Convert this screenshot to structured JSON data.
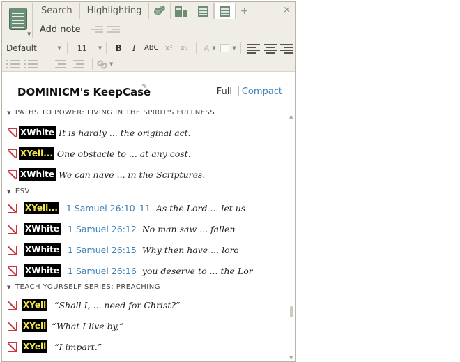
{
  "toolbar": {
    "tabs": [
      {
        "label": "Search"
      },
      {
        "label": "Highlighting"
      }
    ],
    "icon_tabs": [
      "gears-icon",
      "library-icon",
      "notes-icon",
      "notes-active-icon"
    ],
    "add_tab": "+",
    "close": "×",
    "add_note_label": "Add note",
    "style_select": "Default",
    "font_size": "11",
    "bold": "B",
    "italic": "I",
    "smallcaps": "ABC",
    "superscript": "x²",
    "subscript": "x₂",
    "font_color": "A"
  },
  "document": {
    "title": "DOMINICM's KeepCase",
    "view_full": "Full",
    "view_compact": "Compact"
  },
  "sections": [
    {
      "heading": "PATHS TO POWER: LIVING IN THE SPIRIT'S FULLNESS",
      "items": [
        {
          "badge": "XWhite",
          "badge_style": "white",
          "excerpt": "It is hardly ... the original act."
        },
        {
          "badge": "XYell...",
          "badge_style": "yell",
          "excerpt": "One obstacle to ... at any cost."
        },
        {
          "badge": "XWhite",
          "badge_style": "white",
          "excerpt": "We can have ... in the Scriptures."
        }
      ]
    },
    {
      "heading": "ESV",
      "items": [
        {
          "badge": "XYell...",
          "badge_style": "yell",
          "ref": "1 Samuel 26:10–11",
          "excerpt": "As the Lord ... let us"
        },
        {
          "badge": "XWhite",
          "badge_style": "white",
          "ref": "1 Samuel 26:12",
          "excerpt": "No man saw ... fallen up"
        },
        {
          "badge": "XWhite",
          "badge_style": "white",
          "ref": "1 Samuel 26:15",
          "excerpt": "Why then have ... lord a"
        },
        {
          "badge": "XWhite",
          "badge_style": "white",
          "ref": "1 Samuel 26:16",
          "excerpt": "you deserve to ... the Lord."
        }
      ]
    },
    {
      "heading": "TEACH YOURSELF SERIES: PREACHING",
      "items": [
        {
          "badge": "XYell",
          "badge_style": "yell",
          "excerpt": "“Shall I, ... need for Christ?”"
        },
        {
          "badge": "XYell",
          "badge_style": "yell",
          "excerpt": "“What I live by,”"
        },
        {
          "badge": "XYell",
          "badge_style": "yell",
          "excerpt": "“I impart.”"
        }
      ]
    }
  ]
}
